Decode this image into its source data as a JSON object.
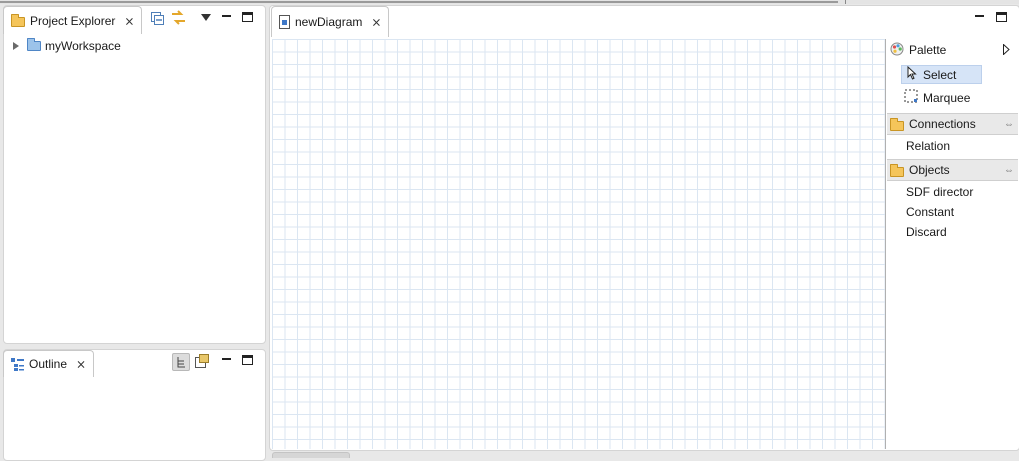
{
  "project_explorer": {
    "tab_label": "Project Explorer",
    "tree": [
      {
        "label": "myWorkspace"
      }
    ]
  },
  "outline": {
    "tab_label": "Outline"
  },
  "editor": {
    "tab_label": "newDiagram"
  },
  "palette": {
    "title": "Palette",
    "tools": [
      {
        "label": "Select"
      },
      {
        "label": "Marquee"
      }
    ],
    "drawers": [
      {
        "label": "Connections",
        "entries": [
          {
            "label": "Relation"
          }
        ]
      },
      {
        "label": "Objects",
        "entries": [
          {
            "label": "SDF director"
          },
          {
            "label": "Constant"
          },
          {
            "label": "Discard"
          }
        ]
      }
    ]
  },
  "icons": {
    "close": "close-icon",
    "minimize": "minimize-icon",
    "maximize": "maximize-icon",
    "collapse_all": "collapse-all-icon",
    "link_editor": "link-with-editor-icon",
    "view_menu": "view-menu-icon",
    "expand_arrow": "expand-arrow-icon",
    "folder": "folder-icon",
    "select_arrow": "arrow-cursor-icon",
    "marquee": "marquee-icon",
    "pin": "pin-icon"
  },
  "colors": {
    "canvas_grid": "#dbe6f2",
    "selected_tool": "#d6e4f7"
  }
}
